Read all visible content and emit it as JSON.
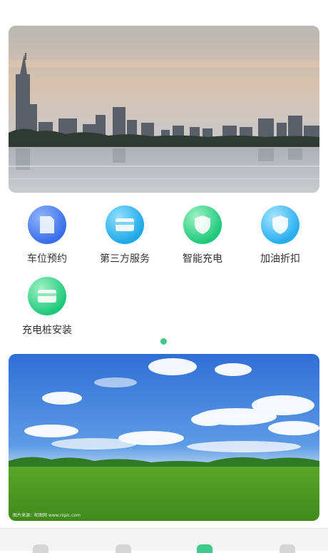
{
  "banners": {
    "top": {
      "scene": "city-skyline-lake"
    },
    "bottom": {
      "scene": "blue-sky-grassland",
      "credit": "图片来源：昵图网 www.nipic.com"
    }
  },
  "services": [
    {
      "label": "车位预约",
      "icon": "parking-reservation-icon",
      "color": "#3a6fe8"
    },
    {
      "label": "第三方服务",
      "icon": "card-icon",
      "color": "#1fa8e8"
    },
    {
      "label": "智能充电",
      "icon": "shield-icon",
      "color": "#1fc97a"
    },
    {
      "label": "加油折扣",
      "icon": "shield-icon",
      "color": "#27aef0"
    },
    {
      "label": "充电桩安装",
      "icon": "card-icon",
      "color": "#1fc97a"
    }
  ],
  "pager": {
    "active_index": 0,
    "color": "#3ec98a"
  }
}
